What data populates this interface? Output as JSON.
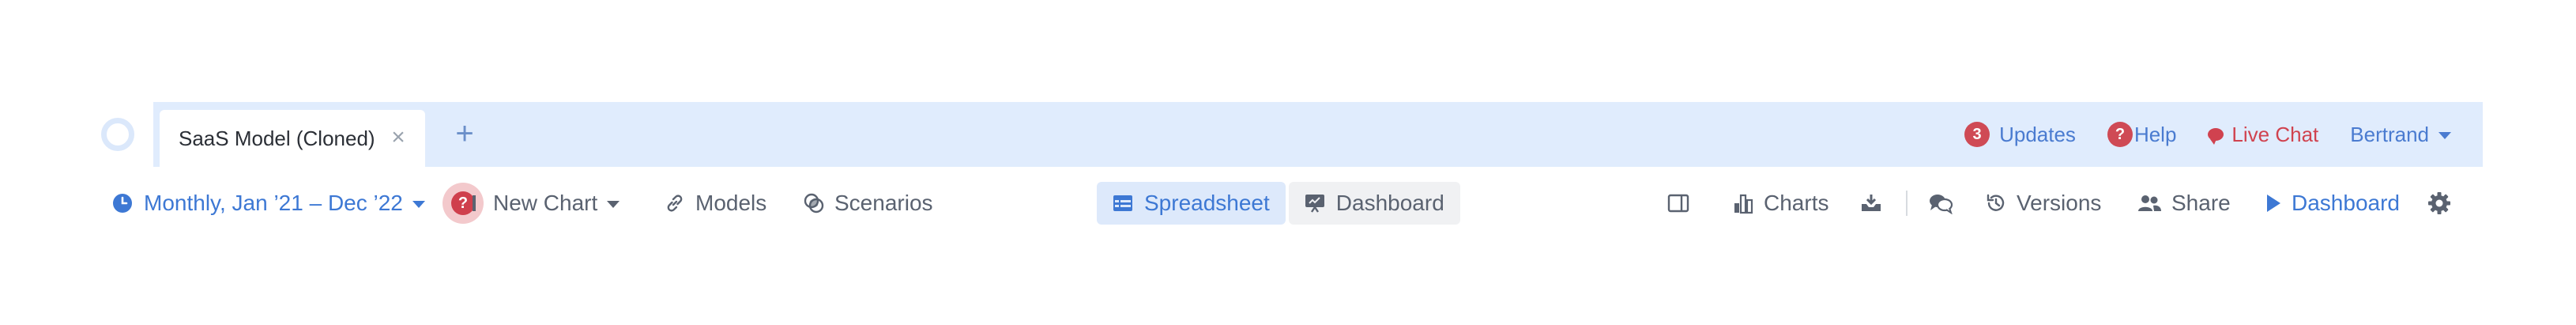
{
  "tabs": [
    {
      "title": "SaaS Model (Cloned)",
      "close_glyph": "×"
    }
  ],
  "tab_add_glyph": "+",
  "header_right": {
    "updates_count": "3",
    "updates_label": "Updates",
    "help_glyph": "?",
    "help_label": "Help",
    "live_chat_label": "Live Chat",
    "user_label": "Bertrand"
  },
  "toolbar": {
    "period_label": "Monthly, Jan ’21 – Dec ’22",
    "help_glyph": "?",
    "new_chart_label": "New Chart",
    "models_label": "Models",
    "scenarios_label": "Scenarios",
    "views": [
      {
        "label": "Spreadsheet",
        "active": true
      },
      {
        "label": "Dashboard",
        "active": false
      }
    ],
    "charts_label": "Charts",
    "versions_label": "Versions",
    "share_label": "Share",
    "dashboard_label": "Dashboard"
  },
  "icons": {
    "logo": "logo-ring-icon",
    "period": "clock-icon",
    "models": "link-icon",
    "scenarios": "scenarios-circles-icon",
    "spreadsheet": "spreadsheet-icon",
    "dashboard_view": "presentation-icon",
    "panel": "panel-toggle-icon",
    "charts": "bar-chart-icon",
    "download": "download-icon",
    "comments": "comments-icon",
    "versions": "history-icon",
    "share": "users-icon",
    "dashboard_play": "play-icon",
    "settings": "gear-icon"
  },
  "colors": {
    "tabbar_bg": "#e0ecfd",
    "accent_blue": "#3d78d4",
    "alert_red": "#cf4a55",
    "text_gray": "#5a6270"
  }
}
